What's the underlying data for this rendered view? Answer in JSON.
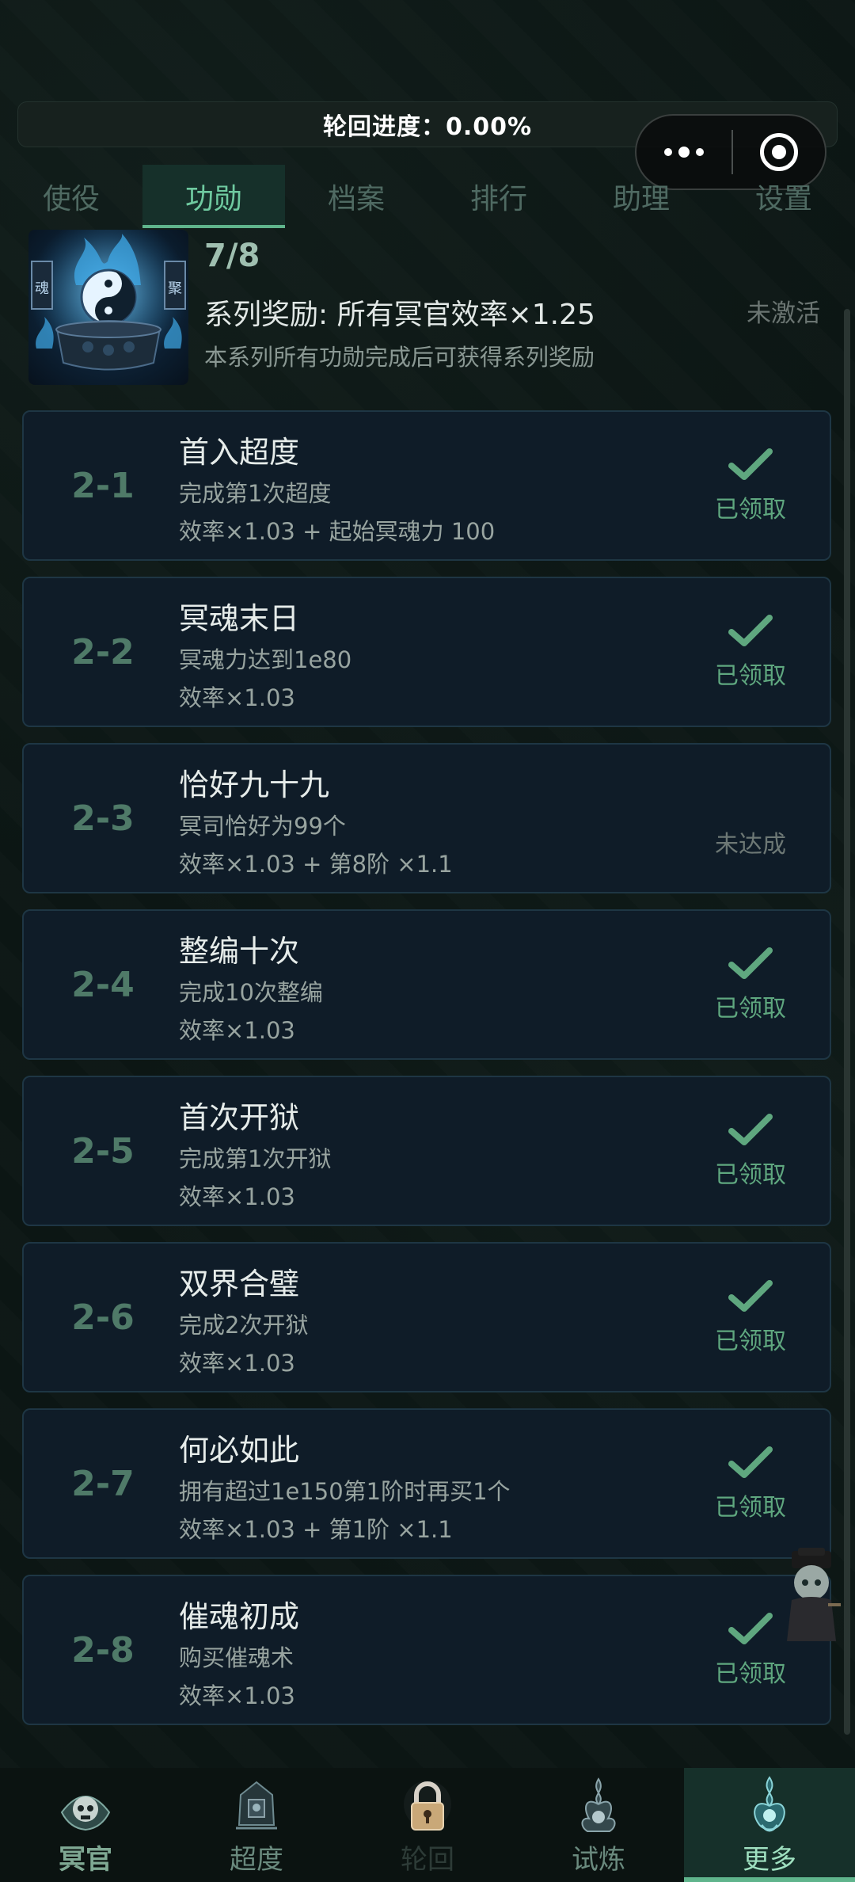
{
  "progress": {
    "label": "轮回进度：0.00%",
    "value_fraction": 0.0
  },
  "tabs": [
    {
      "label": "使役",
      "active": false
    },
    {
      "label": "功勋",
      "active": true
    },
    {
      "label": "档案",
      "active": false
    },
    {
      "label": "排行",
      "active": false
    },
    {
      "label": "助理",
      "active": false
    },
    {
      "label": "设置",
      "active": false
    }
  ],
  "series": {
    "count": "7/8",
    "bonus": "系列奖励: 所有冥官效率×1.25",
    "desc": "本系列所有功勋完成后可获得系列奖励",
    "status": "未激活",
    "seal_left": "魂",
    "seal_right": "聚"
  },
  "achievements": [
    {
      "id": "2-1",
      "title": "首入超度",
      "desc": "完成第1次超度",
      "reward": "效率×1.03 + 起始冥魂力 100",
      "status": "已领取",
      "claimed": true
    },
    {
      "id": "2-2",
      "title": "冥魂末日",
      "desc": "冥魂力达到1e80",
      "reward": "效率×1.03",
      "status": "已领取",
      "claimed": true
    },
    {
      "id": "2-3",
      "title": "恰好九十九",
      "desc": "冥司恰好为99个",
      "reward": "效率×1.03 + 第8阶 ×1.1",
      "status": "未达成",
      "claimed": false
    },
    {
      "id": "2-4",
      "title": "整编十次",
      "desc": "完成10次整编",
      "reward": "效率×1.03",
      "status": "已领取",
      "claimed": true
    },
    {
      "id": "2-5",
      "title": "首次开狱",
      "desc": "完成第1次开狱",
      "reward": "效率×1.03",
      "status": "已领取",
      "claimed": true
    },
    {
      "id": "2-6",
      "title": "双界合璧",
      "desc": "完成2次开狱",
      "reward": "效率×1.03",
      "status": "已领取",
      "claimed": true
    },
    {
      "id": "2-7",
      "title": "何必如此",
      "desc": "拥有超过1e150第1阶时再买1个",
      "reward": "效率×1.03 + 第1阶 ×1.1",
      "status": "已领取",
      "claimed": true
    },
    {
      "id": "2-8",
      "title": "催魂初成",
      "desc": "购买催魂术",
      "reward": "效率×1.03",
      "status": "已领取",
      "claimed": true
    }
  ],
  "bottom_nav": [
    {
      "label": "冥官",
      "icon": "skull-emblem-icon",
      "active": false,
      "locked": false
    },
    {
      "label": "超度",
      "icon": "lantern-emblem-icon",
      "active": false,
      "locked": false
    },
    {
      "label": "轮回",
      "icon": "lock-icon",
      "active": false,
      "locked": true
    },
    {
      "label": "试炼",
      "icon": "flame-emblem-icon",
      "active": false,
      "locked": false
    },
    {
      "label": "更多",
      "icon": "spirit-flame-icon",
      "active": true,
      "locked": false
    }
  ],
  "colors": {
    "accent": "#5fb48c",
    "claimed": "#5fa77f",
    "card_bg": "#0f1c28",
    "page_bg": "#0c1614"
  }
}
